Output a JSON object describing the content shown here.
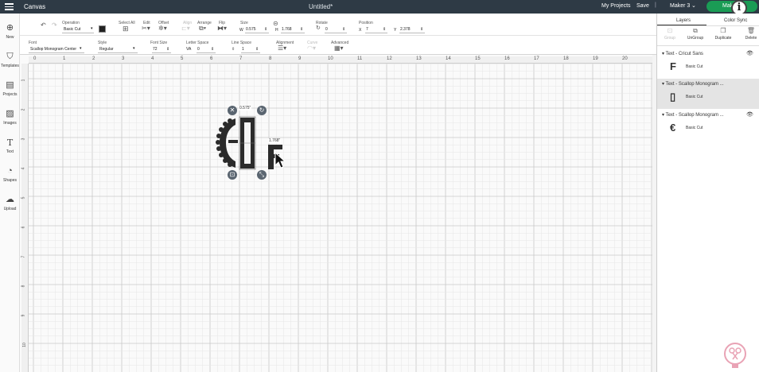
{
  "app": {
    "section": "Canvas",
    "document_title": "Untitled*"
  },
  "header": {
    "my_projects": "My Projects",
    "save": "Save",
    "separator": "|",
    "machine": "Maker 3",
    "make_it": "Make It",
    "info": "i"
  },
  "leftnav": [
    {
      "label": "New",
      "icon": "plus-circle-icon"
    },
    {
      "label": "Templates",
      "icon": "shirt-icon"
    },
    {
      "label": "Projects",
      "icon": "book-icon"
    },
    {
      "label": "Images",
      "icon": "image-icon"
    },
    {
      "label": "Text",
      "icon": "text-icon"
    },
    {
      "label": "Shapes",
      "icon": "shapes-icon"
    },
    {
      "label": "Upload",
      "icon": "cloud-upload-icon"
    }
  ],
  "toolbar1": {
    "operation_label": "Operation",
    "operation_value": "Basic Cut",
    "select_all": "Select All",
    "edit": "Edit",
    "offset": "Offset",
    "align": "Align",
    "arrange": "Arrange",
    "flip": "Flip",
    "size": "Size",
    "w_label": "W",
    "w_value": "0.575",
    "h_label": "H",
    "h_value": "1.768",
    "rotate": "Rotate",
    "rotate_value": "0",
    "position": "Position",
    "x_label": "X",
    "x_value": "7",
    "y_label": "Y",
    "y_value": "2.378"
  },
  "toolbar2": {
    "font_label": "Font",
    "font_value": "Scallop Monogram Center",
    "style_label": "Style",
    "style_value": "Regular",
    "font_size_label": "Font Size",
    "font_size_value": "72",
    "letter_space_label": "Letter Space",
    "letter_space_value": "0",
    "line_space_label": "Line Space",
    "line_space_value": "1",
    "alignment_label": "Alignment",
    "curve_label": "Curve",
    "advanced_label": "Advanced"
  },
  "rulers": {
    "x": [
      "0",
      "1",
      "2",
      "3",
      "4",
      "5",
      "6",
      "7",
      "8",
      "9",
      "10",
      "11",
      "12",
      "13",
      "14",
      "15",
      "16",
      "17",
      "18",
      "19",
      "20"
    ],
    "y": [
      "1",
      "2",
      "3",
      "4",
      "5",
      "6",
      "7",
      "8",
      "9",
      "10"
    ]
  },
  "selection": {
    "width_label": "0.575\"",
    "height_label": "1.768\""
  },
  "panel": {
    "tabs": [
      "Layers",
      "Color Sync"
    ],
    "actions": [
      "Group",
      "UnGroup",
      "Duplicate",
      "Delete"
    ],
    "layers": [
      {
        "name": "Text - Cricut Sans",
        "thumb": "F",
        "operation": "Basic Cut"
      },
      {
        "name": "Text - Scallop Monogram ...",
        "thumb": "▯",
        "operation": "Basic Cut"
      },
      {
        "name": "Text - Scallop Monogram ...",
        "thumb": "€",
        "operation": "Basic Cut"
      }
    ]
  }
}
